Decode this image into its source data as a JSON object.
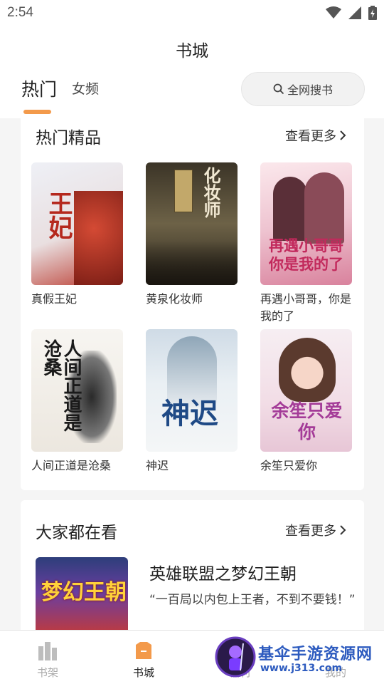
{
  "status": {
    "time": "2:54"
  },
  "header": {
    "title": "书城",
    "tabs": [
      {
        "label": "热门"
      },
      {
        "label": "女频"
      }
    ],
    "search_label": "全网搜书"
  },
  "sections": [
    {
      "title": "热门精品",
      "more": "查看更多",
      "books": [
        {
          "title": "真假王妃",
          "cover_text": "王妃",
          "cover_colors": [
            "#f3e9e2",
            "#c8402f"
          ]
        },
        {
          "title": "黄泉化妆师",
          "cover_text": "化妆师",
          "cover_colors": [
            "#2f2a21",
            "#8a7a58"
          ]
        },
        {
          "title": "再遇小哥哥，你是我的了",
          "cover_text": "再遇小哥哥你是我的了",
          "cover_colors": [
            "#f7d7df",
            "#c63a6a"
          ]
        },
        {
          "title": "人间正道是沧桑",
          "cover_text": "人间正道是沧桑",
          "cover_colors": [
            "#f4f1ec",
            "#2b2b2b"
          ]
        },
        {
          "title": "神迟",
          "cover_text": "神迟",
          "cover_colors": [
            "#dfe9f0",
            "#2f5f8f"
          ]
        },
        {
          "title": "余笙只爱你",
          "cover_text": "余笙只爱你",
          "cover_colors": [
            "#f4e6ee",
            "#b04a9a"
          ]
        }
      ]
    },
    {
      "title": "大家都在看",
      "more": "查看更多",
      "featured": {
        "title": "英雄联盟之梦幻王朝",
        "desc": "“一百局以内包上王者，不到不要钱！”",
        "cover_text": "梦幻王朝"
      }
    }
  ],
  "bottom_nav": [
    {
      "label": "书架",
      "icon": "bookshelf-icon",
      "active": false
    },
    {
      "label": "书城",
      "icon": "bookstore-icon",
      "active": true
    },
    {
      "label": "福利",
      "icon": "gift-icon",
      "active": false
    },
    {
      "label": "我的",
      "icon": "profile-icon",
      "active": false
    }
  ],
  "watermark": {
    "line1": "基伞手游资源网",
    "line2": "www.j313.com"
  },
  "colors": {
    "accent": "#f39a4b",
    "background": "#f5f5f5"
  }
}
